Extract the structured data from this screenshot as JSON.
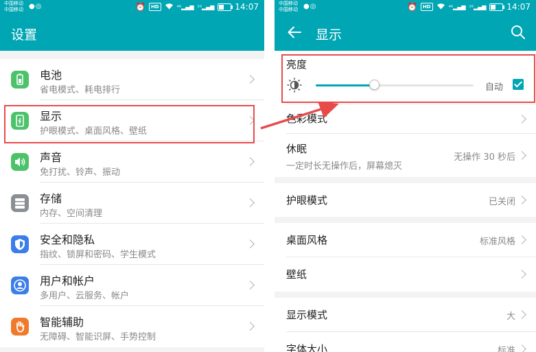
{
  "status_bar": {
    "carrier_1": "中国移动",
    "carrier_2": "中国移动",
    "signal_1": "⁴⁶",
    "signal_2": "²⁶",
    "hd": "HD",
    "time": "14:07"
  },
  "settings": {
    "title": "设置",
    "items": [
      {
        "title": "电池",
        "subtitle": "省电模式、耗电排行",
        "icon": "battery-icon",
        "color": "#4cc36b"
      },
      {
        "title": "显示",
        "subtitle": "护眼模式、桌面风格、壁纸",
        "icon": "display-icon",
        "color": "#4cc36b"
      },
      {
        "title": "声音",
        "subtitle": "免打扰、铃声、振动",
        "icon": "sound-icon",
        "color": "#4cc36b"
      },
      {
        "title": "存储",
        "subtitle": "内存、空间清理",
        "icon": "storage-icon",
        "color": "#8a8f95"
      },
      {
        "title": "安全和隐私",
        "subtitle": "指纹、锁屏和密码、学生模式",
        "icon": "shield-icon",
        "color": "#3b7de9"
      },
      {
        "title": "用户和帐户",
        "subtitle": "多用户、云服务、帐户",
        "icon": "user-icon",
        "color": "#3b7de9"
      },
      {
        "title": "智能辅助",
        "subtitle": "无障碍、智能识屏、手势控制",
        "icon": "hand-icon",
        "color": "#f07a2b"
      }
    ]
  },
  "display": {
    "title": "显示",
    "brightness": {
      "label": "亮度",
      "auto_label": "自动",
      "auto_checked": true,
      "level": 0.37
    },
    "items": [
      {
        "title": "色彩模式",
        "value": ""
      },
      {
        "title": "休眠",
        "subtitle": "一定时长无操作后，屏幕熄灭",
        "value": "无操作 30 秒后"
      },
      {
        "title": "护眼模式",
        "value": "已关闭"
      },
      {
        "title": "桌面风格",
        "value": "标准风格"
      },
      {
        "title": "壁纸",
        "value": ""
      },
      {
        "title": "显示模式",
        "value": "大"
      },
      {
        "title": "字体大小",
        "value": "标准"
      }
    ]
  },
  "colors": {
    "accent": "#00a6b4",
    "highlight": "#e84a4a"
  }
}
